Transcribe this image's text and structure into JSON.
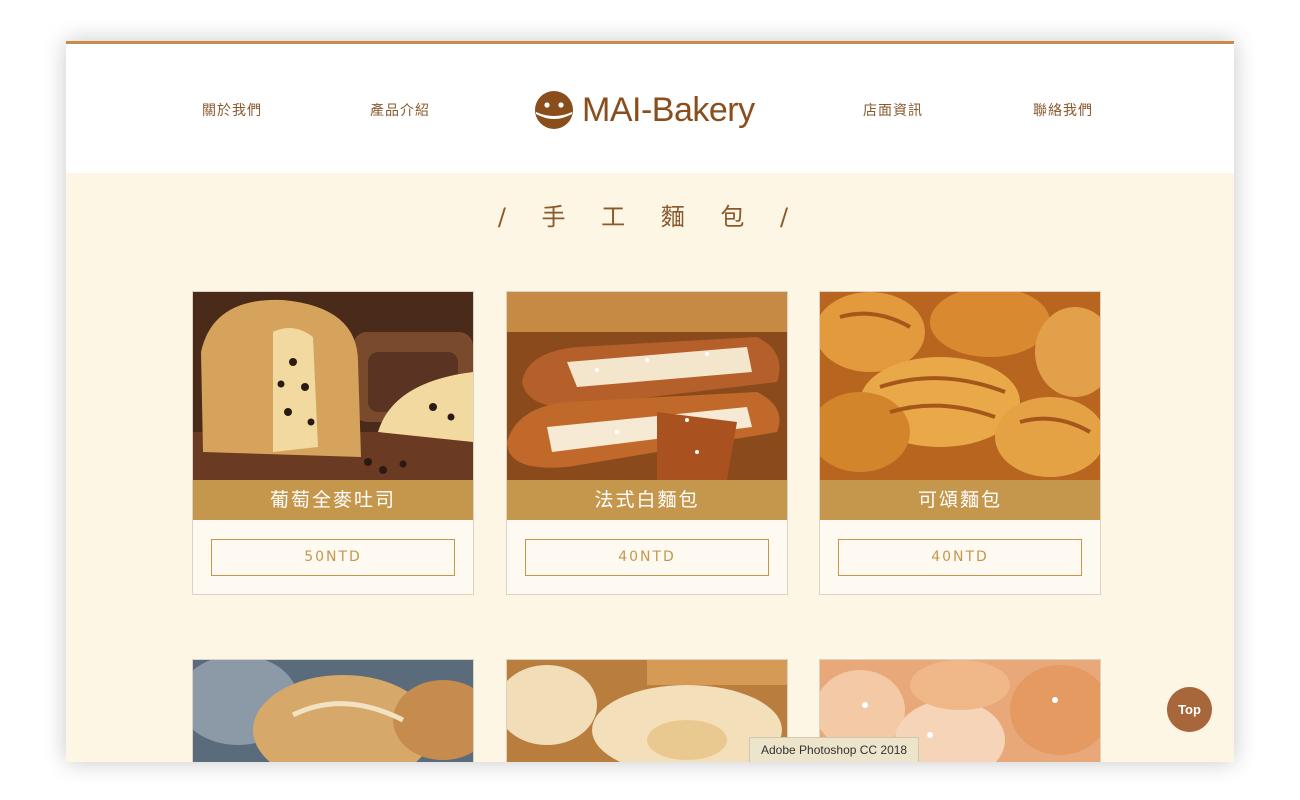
{
  "nav": {
    "about": "關於我們",
    "products": "產品介紹",
    "stores": "店面資訊",
    "contact": "聯絡我們"
  },
  "logo": {
    "text": "MAI-Bakery"
  },
  "section": {
    "title": "/ 手 工 麵 包 /"
  },
  "products": [
    {
      "name": "葡萄全麥吐司",
      "price": "50NTD"
    },
    {
      "name": "法式白麵包",
      "price": "40NTD"
    },
    {
      "name": "可頌麵包",
      "price": "40NTD"
    }
  ],
  "top_button": {
    "label": "Top"
  },
  "tooltip": {
    "text": "Adobe Photoshop CC 2018"
  },
  "colors": {
    "accent": "#c4974d",
    "brand": "#8a4e1c",
    "background": "#fef6e4",
    "top_border": "#c98a4e"
  }
}
